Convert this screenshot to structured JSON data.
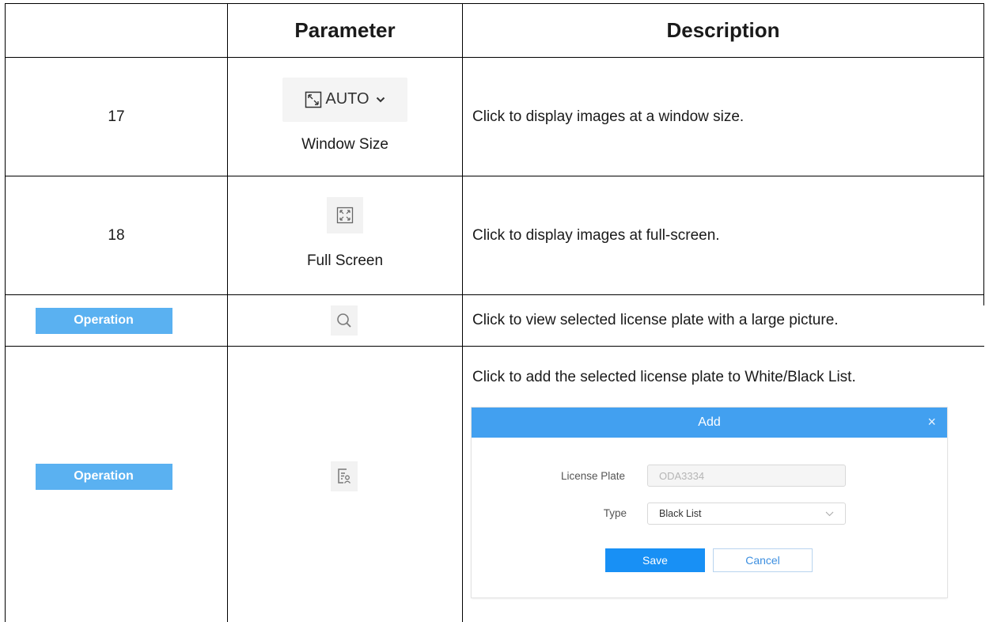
{
  "table": {
    "headers": {
      "index": "",
      "parameter": "Parameter",
      "description": "Description"
    },
    "rows": [
      {
        "index": "17",
        "widget_icon": "expand-corner-icon",
        "widget_text": "AUTO",
        "widget_caret": "chevron-down-icon",
        "parameter": "Window Size",
        "description": "Click to display images at a window size."
      },
      {
        "index": "18",
        "widget_icon": "fullscreen-icon",
        "parameter": "Full Screen",
        "description": "Click to display images at full-screen."
      },
      {
        "index": "Operation",
        "widget_icon": "search-icon",
        "description": "Click to view selected license plate with a large picture."
      },
      {
        "index": "Operation",
        "widget_icon": "list-add-user-icon",
        "description": "Click to add the selected license plate to White/Black List."
      }
    ]
  },
  "dialog": {
    "title": "Add",
    "close": "×",
    "license_plate_label": "License Plate",
    "license_plate_value": "ODA3334",
    "type_label": "Type",
    "type_value": "Black List",
    "save": "Save",
    "cancel": "Cancel"
  },
  "colors": {
    "operation_badge": "#5ab1f1",
    "dialog_header": "#42a0f0",
    "save_button": "#1890f5"
  }
}
